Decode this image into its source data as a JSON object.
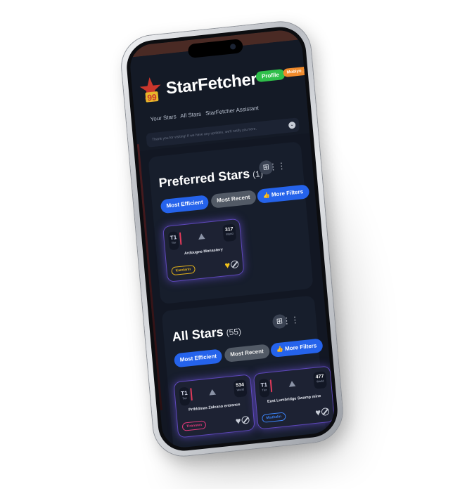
{
  "app": {
    "name": "StarFetcher",
    "logo_number": "99",
    "profile_label": "Profile",
    "user_label": "Mobiyo_fr"
  },
  "nav": {
    "items": [
      "Your Stars",
      "All Stars",
      "StarFetcher Assistant"
    ]
  },
  "notice": {
    "text": "Thank you for visiting! If we have any updates, we'll notify you here.",
    "icon": "chevron-down-icon"
  },
  "preferred": {
    "title": "Preferred Stars",
    "count": "(1)",
    "sort_efficient": "Most Efficient",
    "sort_recent": "Most Recent",
    "filters": "More Filters",
    "cards": [
      {
        "tier": "T1",
        "tier_sub": "Tier",
        "world": "317",
        "world_sub": "World",
        "location": "Ardougne Monastery",
        "region": "Kandarin",
        "favorited": true
      }
    ]
  },
  "all": {
    "title": "All Stars",
    "count": "(55)",
    "sort_efficient": "Most Efficient",
    "sort_recent": "Most Recent",
    "filters": "More Filters",
    "cards": [
      {
        "tier": "T1",
        "tier_sub": "Tier",
        "world": "534",
        "world_sub": "World",
        "location": "Prifddinas Zalcano entrance",
        "region": "Tirannwn",
        "favorited": false
      },
      {
        "tier": "T1",
        "tier_sub": "Tier",
        "world": "477",
        "world_sub": "World",
        "location": "East Lumbridge Swamp mine",
        "region": "Misthalin",
        "favorited": false
      }
    ]
  },
  "colors": {
    "accent_blue": "#2563eb",
    "profile_green": "#2fbf4a",
    "user_orange": "#f08a2b",
    "card_glow": "#7e5cff",
    "kandarin": "#e3b21b",
    "tirannwn": "#e23a7a",
    "misthalin": "#3b82f6"
  }
}
